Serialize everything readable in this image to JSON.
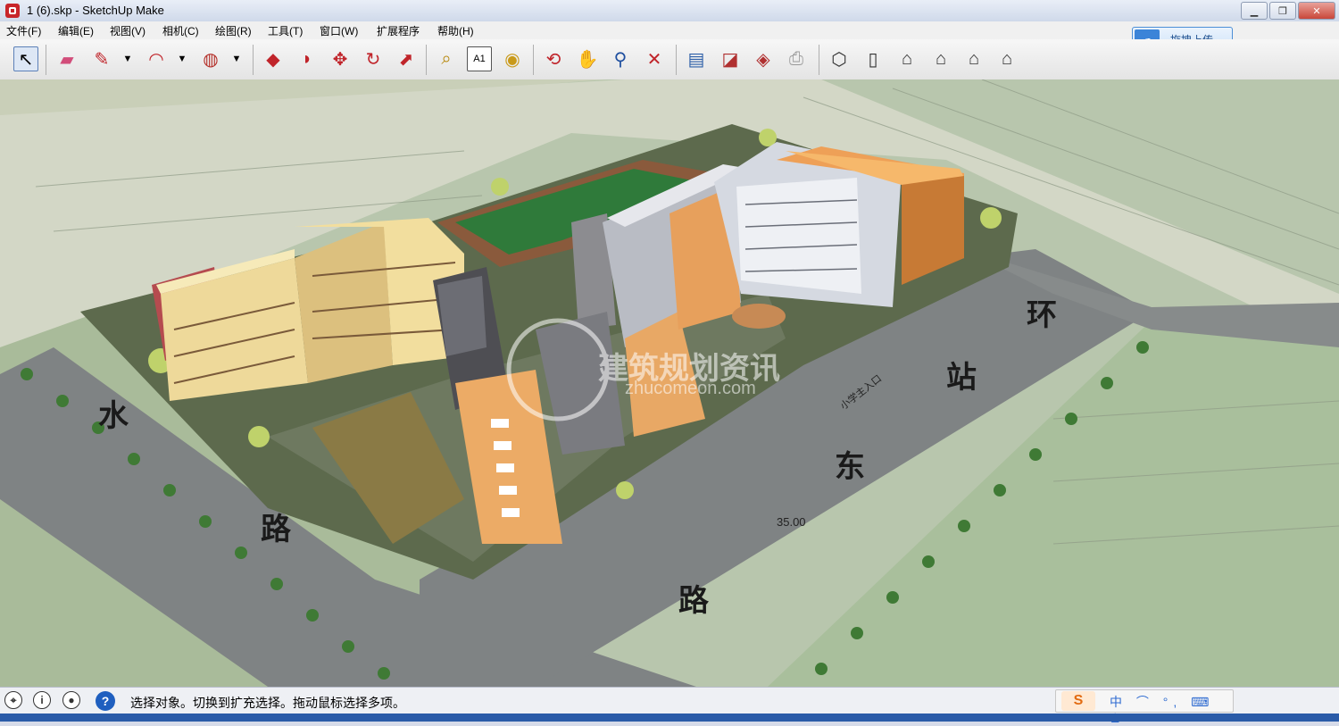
{
  "window": {
    "title": "1 (6).skp - SketchUp Make",
    "minimize": "▁",
    "maximize": "❐",
    "close": "✕"
  },
  "menu": [
    "文件(F)",
    "编辑(E)",
    "视图(V)",
    "相机(C)",
    "绘图(R)",
    "工具(T)",
    "窗口(W)",
    "扩展程序",
    "帮助(H)"
  ],
  "upload": {
    "label": "拖拽上传"
  },
  "toolbar": {
    "tools": [
      {
        "name": "select-tool",
        "glyph": "↖"
      },
      {
        "name": "eraser-tool",
        "glyph": "▰"
      },
      {
        "name": "line-tool",
        "glyph": "✎"
      },
      {
        "name": "line-dropdown",
        "glyph": "▼"
      },
      {
        "name": "arc-tool",
        "glyph": "◠"
      },
      {
        "name": "arc-dropdown",
        "glyph": "▼"
      },
      {
        "name": "shape-tool",
        "glyph": "◍"
      },
      {
        "name": "shape-dropdown",
        "glyph": "▼"
      },
      {
        "name": "push-pull-tool",
        "glyph": "◆"
      },
      {
        "name": "offset-tool",
        "glyph": "◗"
      },
      {
        "name": "move-tool",
        "glyph": "✥"
      },
      {
        "name": "rotate-tool",
        "glyph": "↻"
      },
      {
        "name": "scale-tool",
        "glyph": "⬈"
      },
      {
        "name": "tape-measure-tool",
        "glyph": "⌕"
      },
      {
        "name": "text-tool",
        "glyph": "A1"
      },
      {
        "name": "paint-bucket-tool",
        "glyph": "◉"
      },
      {
        "name": "orbit-tool",
        "glyph": "⟲"
      },
      {
        "name": "pan-tool",
        "glyph": "✋"
      },
      {
        "name": "zoom-tool",
        "glyph": "⚲"
      },
      {
        "name": "zoom-extents-tool",
        "glyph": "✕"
      },
      {
        "name": "previous-view-tool",
        "glyph": "▤"
      },
      {
        "name": "3d-warehouse-tool",
        "glyph": "◪"
      },
      {
        "name": "components-tool",
        "glyph": "◈"
      },
      {
        "name": "send-to-layout-tool",
        "glyph": "⎙"
      },
      {
        "name": "iso-view-icon",
        "glyph": "⬡"
      },
      {
        "name": "top-view-icon",
        "glyph": "▯"
      },
      {
        "name": "front-view-icon",
        "glyph": "⌂"
      },
      {
        "name": "right-view-icon",
        "glyph": "⌂"
      },
      {
        "name": "back-view-icon",
        "glyph": "⌂"
      },
      {
        "name": "left-view-icon",
        "glyph": "⌂"
      }
    ]
  },
  "viewport": {
    "road_labels": [
      "水",
      "路",
      "东",
      "站",
      "路",
      "环"
    ],
    "dimension_label": "35.00",
    "entry_label": "小学主入口",
    "watermark": {
      "name": "建筑规划资讯",
      "url": "zhucomeon.com"
    }
  },
  "status": {
    "text": "选择对象。切换到扩充选择。拖动鼠标选择多项。",
    "icons": [
      "location-icon",
      "info-icon",
      "user-icon",
      "help-icon"
    ],
    "ime": {
      "logo": "S",
      "items": "中 ⌒ °, ⌨ ♟ ✎"
    }
  }
}
